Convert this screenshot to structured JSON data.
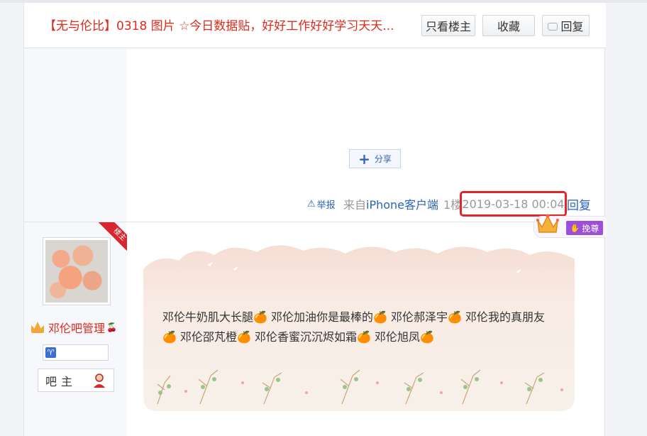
{
  "header": {
    "title": "【无与伦比】0318 图片 ☆今日数据贴，好好工作好好学习天天...",
    "only_louzhu": "只看楼主",
    "favorite": "收藏",
    "reply": "回复"
  },
  "post1": {
    "share_label": "分享",
    "report_label": "举报",
    "client_prefix": "来自",
    "client_name": "iPhone客户端",
    "floor": "1楼",
    "datetime": "2019-03-18 00:04",
    "reply_label": "回复"
  },
  "post2": {
    "badge_label": "楼主",
    "username": "邓伦吧管理",
    "cherry": "🍒",
    "rank_label": "吧主",
    "huanzun_label": "挽尊",
    "content_line1": "邓伦牛奶肌大长腿🍊 邓伦加油你是最棒的🍊 邓伦郝泽宇🍊 邓伦我的真朋友",
    "content_line2": "🍊 邓伦邵芃橙🍊 邓伦香蜜沉沉烬如霜🍊 邓伦旭凤🍊"
  },
  "colors": {
    "title_red": "#e1281b",
    "link_blue": "#2d64b3",
    "highlight_red": "#e0252b",
    "huanzun_purple": "#9c4fd8"
  },
  "icons": {
    "reply_icon": "speech-bubble-icon",
    "share_icon": "plus-icon",
    "report_icon": "warning-icon",
    "zodiac_icon": "aries-icon",
    "rank_icon": "person-icon"
  }
}
